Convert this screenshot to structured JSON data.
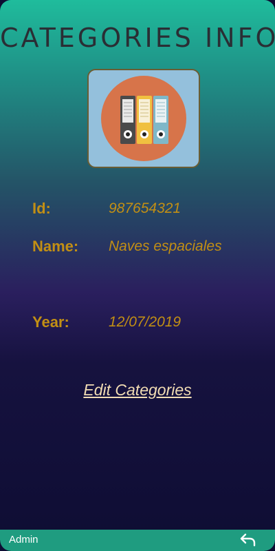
{
  "header": {
    "title": "CATEGORIES INFO"
  },
  "category_image": {
    "icon": "binders-icon",
    "colors": {
      "circle": "#d7744a",
      "background": "#94c0dc"
    }
  },
  "details": {
    "id_label": "Id:",
    "id_value": "987654321",
    "name_label": "Name:",
    "name_value": "Naves espaciales",
    "year_label": "Year:",
    "year_value": "12/07/2019"
  },
  "actions": {
    "edit_label": "Edit Categories"
  },
  "bottom_bar": {
    "user_label": "Admin",
    "back_icon": "undo-arrow-icon"
  },
  "colors": {
    "label": "#c28f14",
    "link": "#f1dcb3",
    "bottom_bar": "#1f9c80"
  }
}
